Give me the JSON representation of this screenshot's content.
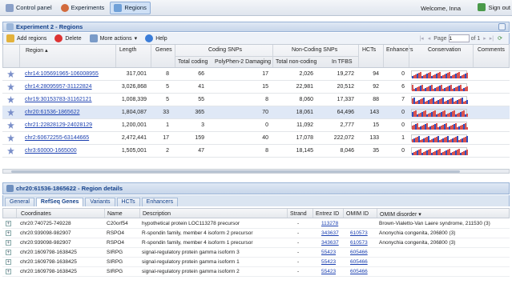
{
  "topbar": {
    "items": [
      "Control panel",
      "Experiments",
      "Regions"
    ],
    "welcome": "Welcome, Inna",
    "signout": "Sign out",
    "icon_names": [
      "control-panel-icon",
      "experiments-icon",
      "regions-icon"
    ]
  },
  "regions_panel": {
    "title": "Experiment 2 - Regions",
    "toolbar": {
      "add": "Add regions",
      "delete": "Delete",
      "more": "More actions",
      "help": "Help",
      "page_label": "Page",
      "page_value": "1",
      "page_of": "of 1"
    },
    "columns": {
      "region": "Region",
      "length": "Length",
      "genes": "Genes",
      "coding_snps": "Coding SNPs",
      "total_coding": "Total coding",
      "polyphen": "PolyPhen-2 Damaging",
      "noncoding_snps": "Non-Coding SNPs",
      "total_noncoding": "Total non-coding",
      "in_tfbs": "In TFBS",
      "hcts": "HCTs",
      "enhancers": "Enhancers",
      "conservation": "Conservation",
      "comments": "Comments"
    },
    "rows": [
      {
        "region": "chr14:105691965-106008955",
        "length": "317,001",
        "genes": "8",
        "total_coding": "66",
        "polyphen": "17",
        "total_noncoding": "2,026",
        "in_tfbs": "19,272",
        "hcts": "94",
        "enhancers": "0"
      },
      {
        "region": "chr14:28095957-31122824",
        "length": "3,026,868",
        "genes": "5",
        "total_coding": "41",
        "polyphen": "15",
        "total_noncoding": "22,981",
        "in_tfbs": "20,512",
        "hcts": "92",
        "enhancers": "6"
      },
      {
        "region": "chr19:30153783-31162121",
        "length": "1,008,339",
        "genes": "5",
        "total_coding": "55",
        "polyphen": "8",
        "total_noncoding": "8,060",
        "in_tfbs": "17,337",
        "hcts": "88",
        "enhancers": "7"
      },
      {
        "region": "chr20:61536-1865622",
        "length": "1,804,087",
        "genes": "33",
        "total_coding": "365",
        "polyphen": "70",
        "total_noncoding": "18,061",
        "in_tfbs": "64,496",
        "hcts": "143",
        "enhancers": "0"
      },
      {
        "region": "chr21:22828129-24028129",
        "length": "1,200,001",
        "genes": "1",
        "total_coding": "3",
        "polyphen": "0",
        "total_noncoding": "11,092",
        "in_tfbs": "2,777",
        "hcts": "15",
        "enhancers": "0"
      },
      {
        "region": "chr2:60672255-63144665",
        "length": "2,472,441",
        "genes": "17",
        "total_coding": "159",
        "polyphen": "40",
        "total_noncoding": "17,078",
        "in_tfbs": "222,072",
        "hcts": "133",
        "enhancers": "1"
      },
      {
        "region": "chr3:60000-1665000",
        "length": "1,505,001",
        "genes": "2",
        "total_coding": "47",
        "polyphen": "8",
        "total_noncoding": "18,145",
        "in_tfbs": "8,046",
        "hcts": "35",
        "enhancers": "0"
      }
    ]
  },
  "details_panel": {
    "title": "chr20:61536-1865622 - Region details",
    "tabs": [
      "General",
      "RefSeq Genes",
      "Variants",
      "HCTs",
      "Enhancers"
    ],
    "columns": {
      "coordinates": "Coordinates",
      "name": "Name",
      "description": "Description",
      "strand": "Strand",
      "entrez": "Entrez ID",
      "omim_id": "OMIM ID",
      "omim_disorder": "OMIM disorder"
    },
    "rows": [
      {
        "coord": "chr20:740725-749228",
        "name": "C20orf54",
        "desc": "hypothetical protein LOC113278 precursor",
        "strand": "-",
        "entrez": "113278",
        "omim": "",
        "disorder": "Brown-Vialetto-Van Laere syndrome, 211530 (3)"
      },
      {
        "coord": "chr20:939098-982907",
        "name": "RSPO4",
        "desc": "R-spondin family, member 4 isoform 2 precursor",
        "strand": "-",
        "entrez": "343637",
        "omim": "610573",
        "disorder": "Anonychia congenita, 206800 (3)"
      },
      {
        "coord": "chr20:939098-982907",
        "name": "RSPO4",
        "desc": "R-spondin family, member 4 isoform 1 precursor",
        "strand": "-",
        "entrez": "343637",
        "omim": "610573",
        "disorder": "Anonychia congenita, 206800 (3)"
      },
      {
        "coord": "chr20:1609798-1638425",
        "name": "SIRPG",
        "desc": "signal-regulatory protein gamma isoform 3",
        "strand": "-",
        "entrez": "55423",
        "omim": "605466",
        "disorder": ""
      },
      {
        "coord": "chr20:1609798-1638425",
        "name": "SIRPG",
        "desc": "signal-regulatory protein gamma isoform 1",
        "strand": "-",
        "entrez": "55423",
        "omim": "605466",
        "disorder": ""
      },
      {
        "coord": "chr20:1609798-1638425",
        "name": "SIRPG",
        "desc": "signal-regulatory protein gamma isoform 2",
        "strand": "-",
        "entrez": "55423",
        "omim": "605466",
        "disorder": ""
      }
    ]
  },
  "colors": {
    "accent": "#15428b",
    "link": "#1a3fb0",
    "selected_row": "#dfe8f6",
    "cons_red": "#d9534f",
    "cons_blue": "#2f4fbf"
  }
}
